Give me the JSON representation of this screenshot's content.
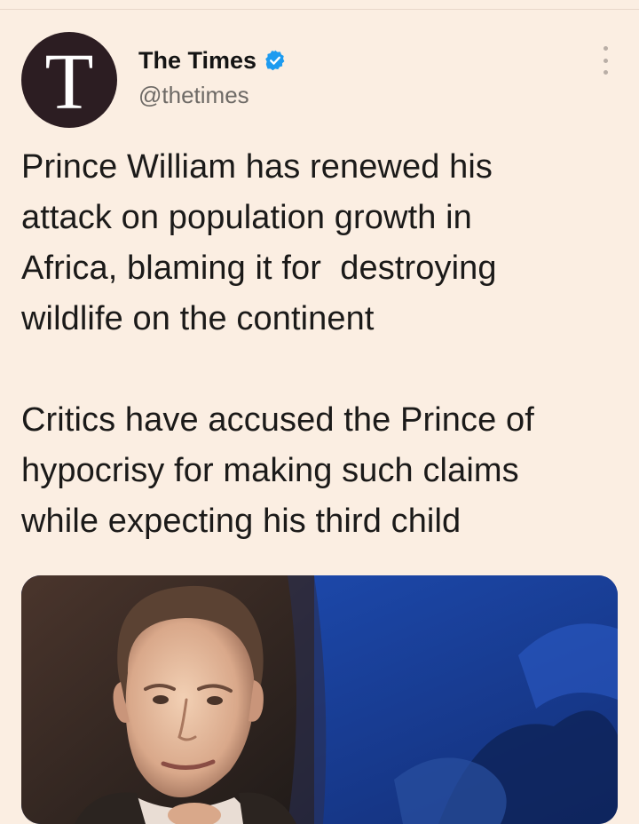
{
  "tweet": {
    "avatar_letter": "T",
    "display_name": "The Times",
    "handle": "@thetimes",
    "verified_icon": "verified-badge-icon",
    "menu_icon": "more-options-icon",
    "paragraph_1_line_1": "Prince William has renewed his",
    "paragraph_1_line_2": "attack on population growth in",
    "paragraph_1_line_3": "Africa, blaming it for  destroying",
    "paragraph_1_line_4": "wildlife on the continent",
    "paragraph_2_line_1": "Critics have accused the Prince of",
    "paragraph_2_line_2": "hypocrisy for making such claims",
    "paragraph_2_line_3": "while expecting his third child"
  },
  "colors": {
    "background": "#fbeee2",
    "avatar_bg": "#2c1d22",
    "verified_blue": "#1d9bf0",
    "text": "#1b1a19",
    "secondary_text": "#6e6a66"
  }
}
